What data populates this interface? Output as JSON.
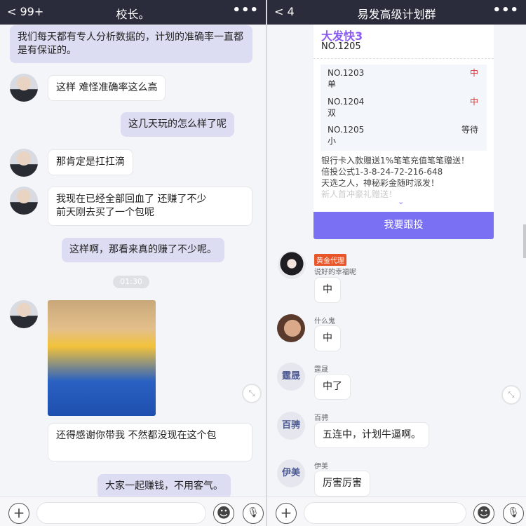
{
  "left": {
    "header": {
      "back": "99+",
      "title": "校长。",
      "more": "•••"
    },
    "messages": [
      {
        "type": "sent",
        "text": "我们每天都有专人分析数据的，计划的准确率一直都是有保证的。"
      },
      {
        "type": "received",
        "text": "这样 难怪准确率这么高"
      },
      {
        "type": "sent",
        "text": "这几天玩的怎么样了呢"
      },
      {
        "type": "received",
        "text": "那肯定是扛扛滴"
      },
      {
        "type": "received",
        "text": "我现在已经全部回血了 还赚了不少\n前天刚去买了一个包呢"
      },
      {
        "type": "sent",
        "text": "这样啊，那看来真的赚了不少呢。"
      },
      {
        "type": "received",
        "text": "还得感谢你带我 不然都没现在这个包"
      },
      {
        "type": "sent",
        "text": "大家一起赚钱，不用客气。"
      }
    ],
    "time": "01:30"
  },
  "right": {
    "header": {
      "back": "4",
      "title": "易发高级计划群",
      "more": "•••"
    },
    "card": {
      "title": "大发快3",
      "number": "NO.1205",
      "history": [
        {
          "no": "NO.1203",
          "pick": "单",
          "status": "中",
          "color": "#d9383a"
        },
        {
          "no": "NO.1204",
          "pick": "双",
          "status": "中",
          "color": "#d9383a"
        },
        {
          "no": "NO.1205",
          "pick": "小",
          "status": "等待",
          "color": "#333333"
        }
      ],
      "promo": [
        "银行卡入款赠送1%笔笔充值笔笔赠送！",
        "倍投公式1-3-8-24-72-216-648",
        "天选之人，神秘彩金随时派发！",
        "新人首冲豪礼赠送！"
      ],
      "follow_button": "我要跟投"
    },
    "messages": [
      {
        "badge": "黄金代理",
        "name": "说好的幸福呢",
        "text": "中"
      },
      {
        "name": "什么鬼",
        "text": "中"
      },
      {
        "name": "霆晟",
        "avatar_text": "霆晟",
        "text": "中了"
      },
      {
        "name": "百骋",
        "avatar_text": "百骋",
        "text": "五连中，计划牛逼啊。"
      },
      {
        "name": "伊美",
        "avatar_text": "伊美",
        "text": "厉害厉害"
      }
    ]
  },
  "icons": {
    "plus": "+",
    "emoji": "☻",
    "mic": "🎙",
    "shrink": "⤡"
  },
  "colors": {
    "header": "#2a2c3b",
    "sent_bubble": "#dcdcf3",
    "accent": "#7a70f3",
    "win": "#d9383a",
    "badge": "#e8562a"
  }
}
